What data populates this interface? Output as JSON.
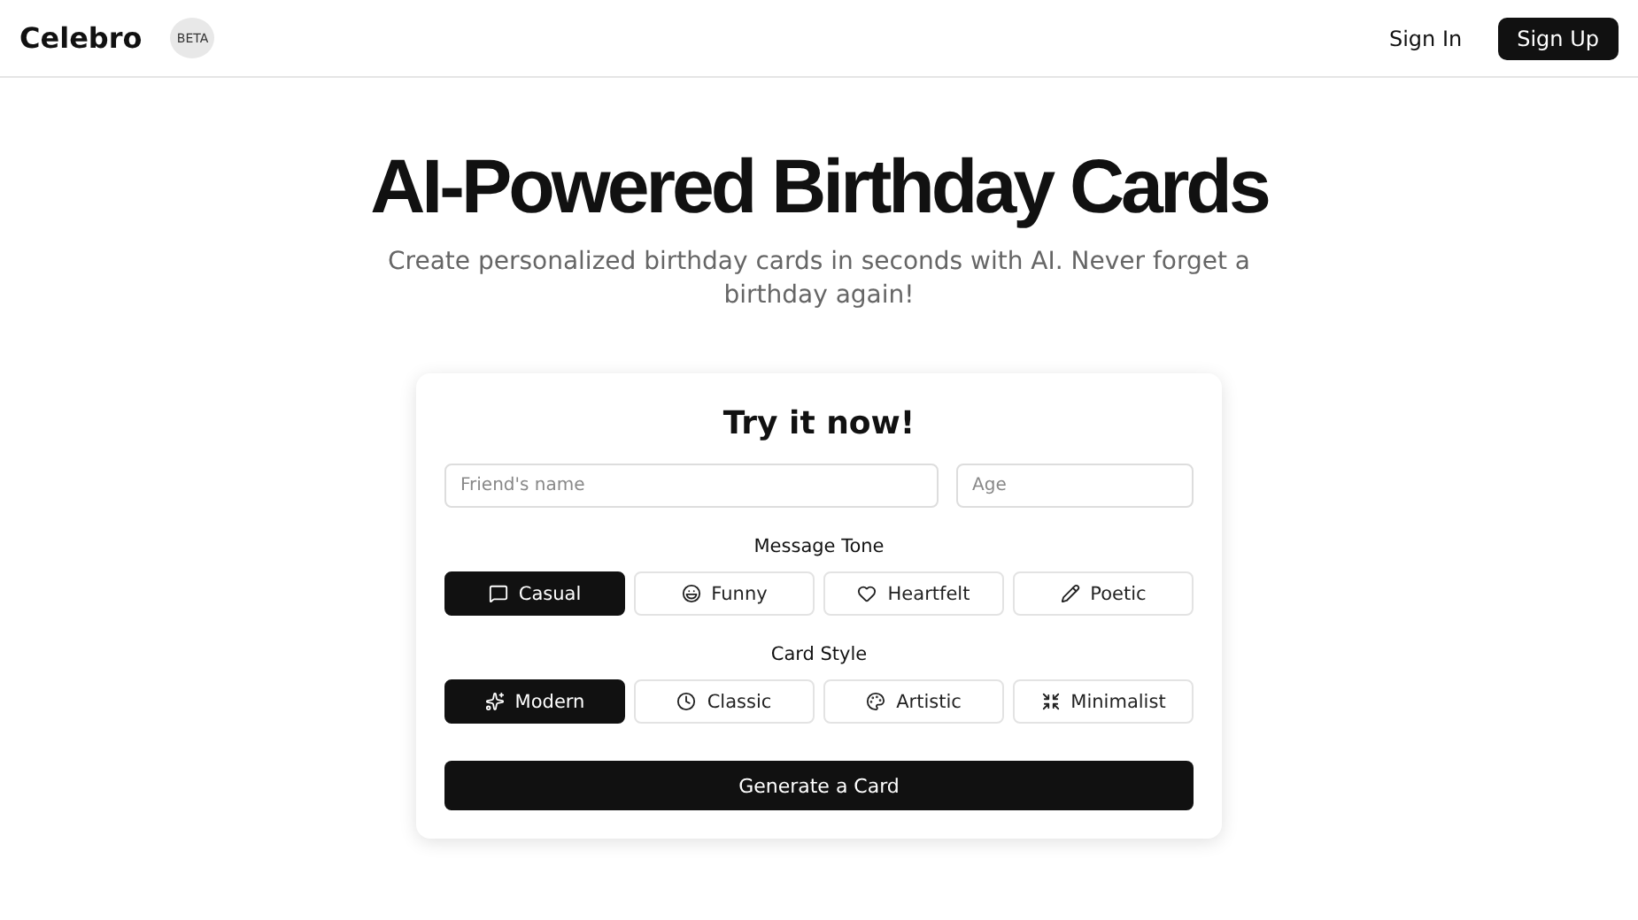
{
  "header": {
    "logo": "Celebro",
    "badge": "BETA",
    "sign_in": "Sign In",
    "sign_up": "Sign Up"
  },
  "hero": {
    "title": "AI-Powered Birthday Cards",
    "subtitle": "Create personalized birthday cards in seconds with AI. Never forget a birthday again!"
  },
  "form": {
    "title": "Try it now!",
    "name_field": {
      "placeholder": "Friend's name"
    },
    "age_field": {
      "placeholder": "Age"
    },
    "tone": {
      "label": "Message Tone",
      "options": [
        {
          "label": "Casual",
          "selected": true
        },
        {
          "label": "Funny",
          "selected": false
        },
        {
          "label": "Heartfelt",
          "selected": false
        },
        {
          "label": "Poetic",
          "selected": false
        }
      ]
    },
    "style": {
      "label": "Card Style",
      "options": [
        {
          "label": "Modern",
          "selected": true
        },
        {
          "label": "Classic",
          "selected": false
        },
        {
          "label": "Artistic",
          "selected": false
        },
        {
          "label": "Minimalist",
          "selected": false
        }
      ]
    },
    "submit": "Generate a Card"
  }
}
